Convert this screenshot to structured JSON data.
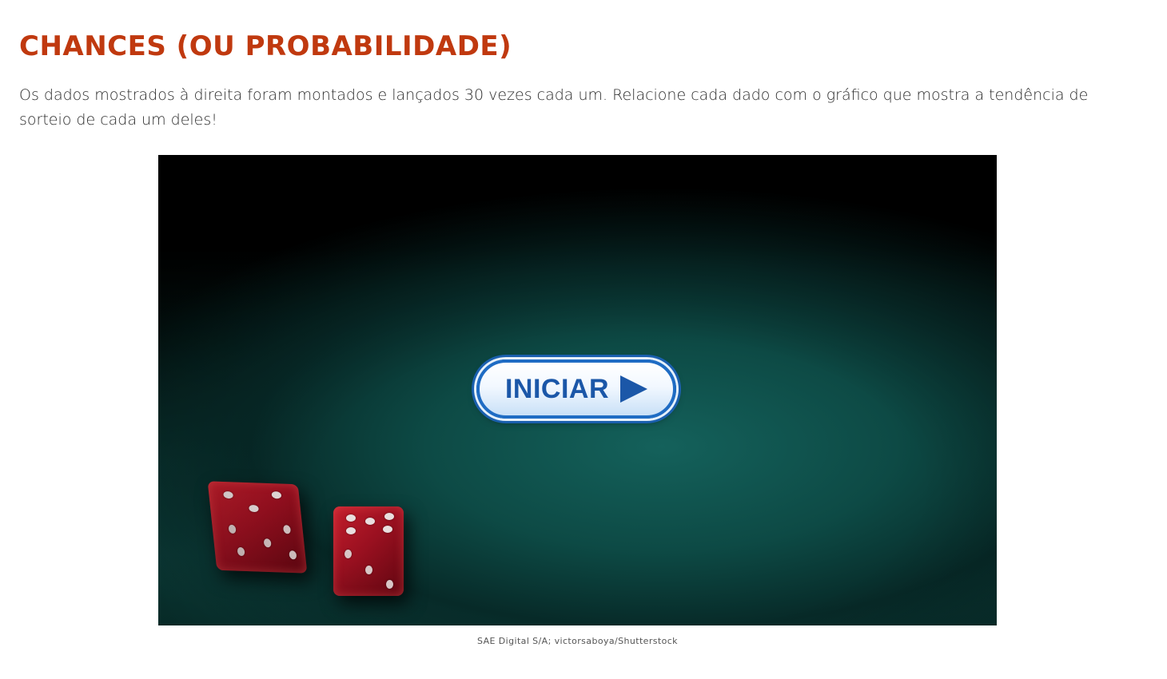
{
  "page": {
    "title": "CHANCES (OU PROBABILIDADE)",
    "intro": "Os dados mostrados à direita foram montados e lançados 30 vezes cada um. Relacione cada dado com o gráfico que mostra a tendência de sorteio de cada um deles!"
  },
  "stage": {
    "start_label": "INICIAR",
    "start_icon": "play-icon",
    "image_subject": "two red dice on green felt"
  },
  "credit": "SAE Digital S/A; victorsaboya/Shutterstock",
  "colors": {
    "title": "#c0390f",
    "button_text": "#1b57a8",
    "button_border": "#1f6cc4",
    "felt": "#0d4a45",
    "dice": "#a1111f"
  }
}
